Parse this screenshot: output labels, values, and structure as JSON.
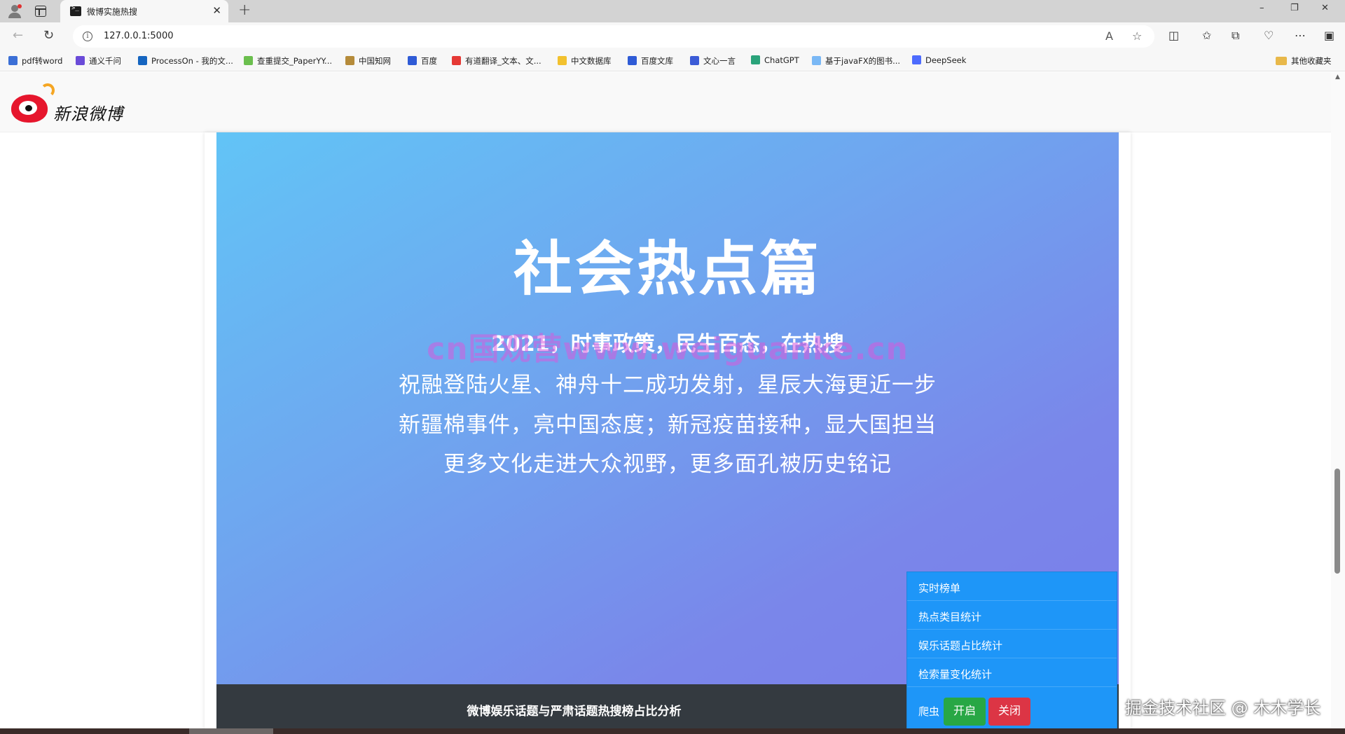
{
  "browser": {
    "tab": {
      "title": "微博实施热搜"
    },
    "new_tab_label": "+",
    "window": {
      "minimize": "–",
      "restore": "❐",
      "close": "✕"
    },
    "address": {
      "url": "127.0.0.1:5000"
    }
  },
  "bookmarks": [
    {
      "label": "pdf转word",
      "color": "#3b6fd6"
    },
    {
      "label": "通义千问",
      "color": "#6a4bd8"
    },
    {
      "label": "ProcessOn - 我的文...",
      "color": "#1565c0"
    },
    {
      "label": "查重提交_PaperYY...",
      "color": "#6bbf4e"
    },
    {
      "label": "中国知网",
      "color": "#b58b3a"
    },
    {
      "label": "百度",
      "color": "#2f5bd6"
    },
    {
      "label": "有道翻译_文本、文...",
      "color": "#e53935"
    },
    {
      "label": "中文数据库",
      "color": "#f2c12e"
    },
    {
      "label": "百度文库",
      "color": "#2f5bd6"
    },
    {
      "label": "文心一言",
      "color": "#3b5bd6"
    },
    {
      "label": "ChatGPT",
      "color": "#2aa37a"
    },
    {
      "label": "基于javaFX的图书...",
      "color": "#7ab8f5"
    },
    {
      "label": "DeepSeek",
      "color": "#4d6bfe"
    }
  ],
  "other_bookmarks": "其他收藏夹",
  "site": {
    "logo_text": "新浪微博"
  },
  "hero": {
    "title": "社会热点篇",
    "subtitle": "2021，时事政策，民生百态，在热搜",
    "lines": [
      "祝融登陆火星、神舟十二成功发射，星辰大海更近一步",
      "新疆棉事件，亮中国态度；新冠疫苗接种，显大国担当",
      "更多文化走进大众视野，更多面孔被历史铭记"
    ],
    "watermark": "cn国观营www.weiguanke.cn"
  },
  "bottom_bar": {
    "title": "微博娱乐话题与严肃话题热搜榜占比分析"
  },
  "menu": {
    "items": [
      "实时榜单",
      "热点类目统计",
      "娱乐话题占比统计",
      "检索量变化统计"
    ],
    "spider_label": "爬虫",
    "start_button": "开启",
    "stop_button": "关闭"
  },
  "credit": "掘金技术社区 @ 木木学长"
}
